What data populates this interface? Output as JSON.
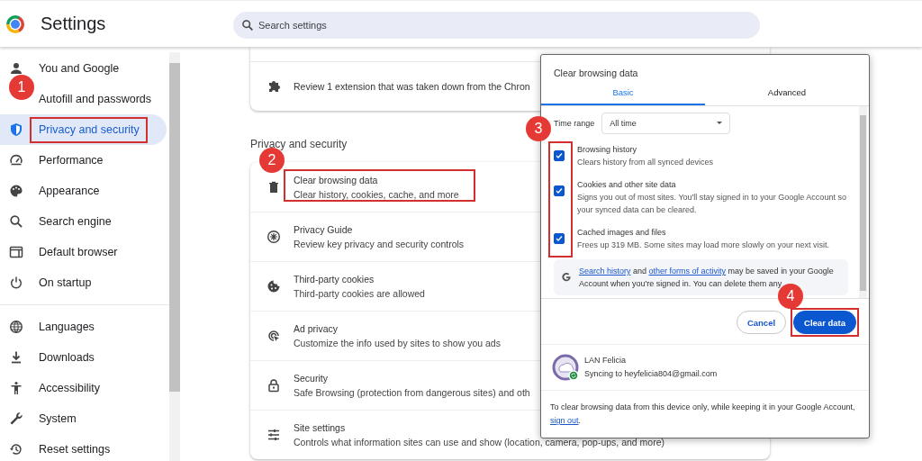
{
  "header": {
    "title": "Settings",
    "search": {
      "placeholder": "Search settings"
    }
  },
  "sidebar": {
    "groups": [
      {
        "items": [
          {
            "label": "You and Google",
            "selected": false,
            "outlined": false
          },
          {
            "label": "Autofill and passwords",
            "selected": false,
            "outlined": false,
            "badge": "1"
          },
          {
            "label": "Privacy and security",
            "selected": true,
            "outlined": true
          },
          {
            "label": "Performance",
            "selected": false,
            "outlined": false
          },
          {
            "label": "Appearance",
            "selected": false,
            "outlined": false
          },
          {
            "label": "Search engine",
            "selected": false,
            "outlined": false
          },
          {
            "label": "Default browser",
            "selected": false,
            "outlined": false
          },
          {
            "label": "On startup",
            "selected": false,
            "outlined": false
          }
        ]
      },
      {
        "items": [
          {
            "label": "Languages",
            "selected": false,
            "outlined": false
          },
          {
            "label": "Downloads",
            "selected": false,
            "outlined": false
          },
          {
            "label": "Accessibility",
            "selected": false,
            "outlined": false
          },
          {
            "label": "System",
            "selected": false,
            "outlined": false
          },
          {
            "label": "Reset settings",
            "selected": false,
            "outlined": false
          }
        ]
      }
    ]
  },
  "main": {
    "extension_notice": "Review 1 extension that was taken down from the Chron",
    "section_title": "Privacy and security",
    "rows": [
      {
        "title": "Clear browsing data",
        "subtitle": "Clear history, cookies, cache, and more",
        "outlined": true,
        "badge": "2"
      },
      {
        "title": "Privacy Guide",
        "subtitle": "Review key privacy and security controls",
        "outlined": false
      },
      {
        "title": "Third-party cookies",
        "subtitle": "Third-party cookies are allowed",
        "outlined": false
      },
      {
        "title": "Ad privacy",
        "subtitle": "Customize the info used by sites to show you ads",
        "outlined": false
      },
      {
        "title": "Security",
        "subtitle": "Safe Browsing (protection from dangerous sites) and oth",
        "outlined": false
      },
      {
        "title": "Site settings",
        "subtitle": "Controls what information sites can use and show (location, camera, pop-ups, and more)",
        "outlined": false
      }
    ]
  },
  "dialog": {
    "title": "Clear browsing data",
    "tabs": [
      {
        "label": "Basic",
        "selected": true
      },
      {
        "label": "Advanced",
        "selected": false
      }
    ],
    "time_range": {
      "label": "Time range",
      "value": "All time"
    },
    "options_badge": "3",
    "options_outlined": true,
    "options": [
      {
        "title": "Browsing history",
        "description": "Clears history from all synced devices",
        "checked": true
      },
      {
        "title": "Cookies and other site data",
        "description": "Signs you out of most sites. You'll stay signed in to your Google Account so your synced data can be cleared.",
        "checked": true
      },
      {
        "title": "Cached images and files",
        "description": "Frees up 319 MB. Some sites may load more slowly on your next visit.",
        "checked": true
      }
    ],
    "info": {
      "link_1": "Search history",
      "text_1": "and",
      "link_2": "other forms of activity",
      "text_2": "may be saved in your Google Account when you're signed in. You can delete them any"
    },
    "buttons": [
      {
        "label": "Cancel",
        "kind": "secondary",
        "outlined": false
      },
      {
        "label": "Clear data",
        "kind": "primary",
        "outlined": true,
        "badge": "4"
      }
    ],
    "account": {
      "name": "LAN Felicia",
      "status": "Syncing to heyfelicia804@gmail.com"
    },
    "footer": {
      "text": "To clear browsing data from this device only, while keeping it in your Google Account,",
      "link": "sign out",
      "end": "."
    }
  }
}
